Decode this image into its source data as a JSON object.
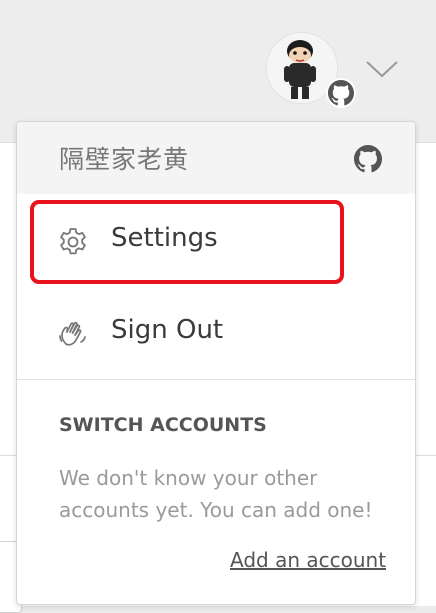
{
  "account_menu": {
    "username": "隔壁家老黄",
    "provider_icon": "github-icon",
    "items": [
      {
        "label": "Settings",
        "icon": "gear-icon"
      },
      {
        "label": "Sign Out",
        "icon": "waving-hand-icon"
      }
    ],
    "switch_accounts": {
      "title": "SWITCH ACCOUNTS",
      "text": "We don't know your other accounts yet. You can add one!",
      "add_link": "Add an account"
    }
  },
  "colors": {
    "highlight": "#e8121c",
    "header_bg": "#f4f4f4",
    "label_text": "#3a3a3a",
    "muted_text": "#9a9a9a"
  }
}
